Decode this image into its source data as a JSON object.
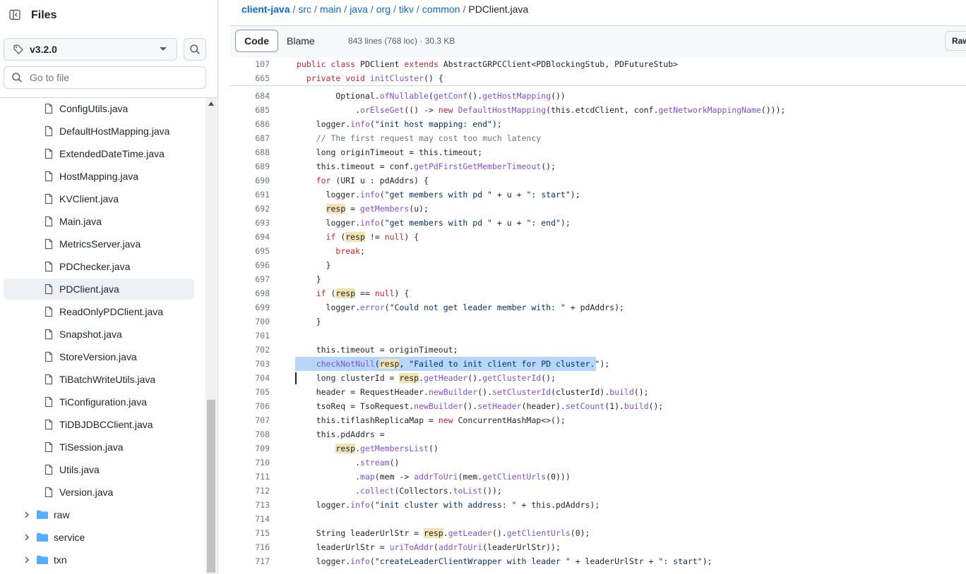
{
  "sidebar": {
    "title": "Files",
    "branch": "v3.2.0",
    "goto_placeholder": "Go to file",
    "files": [
      "ConfigUtils.java",
      "DefaultHostMapping.java",
      "ExtendedDateTime.java",
      "HostMapping.java",
      "KVClient.java",
      "Main.java",
      "MetricsServer.java",
      "PDChecker.java",
      "PDClient.java",
      "ReadOnlyPDClient.java",
      "Snapshot.java",
      "StoreVersion.java",
      "TiBatchWriteUtils.java",
      "TiConfiguration.java",
      "TiDBJDBCClient.java",
      "TiSession.java",
      "Utils.java",
      "Version.java"
    ],
    "selected_file": "PDClient.java",
    "folders": [
      "raw",
      "service",
      "txn"
    ]
  },
  "breadcrumb": {
    "items": [
      "client-java",
      "src",
      "main",
      "java",
      "org",
      "tikv",
      "common"
    ],
    "current": "PDClient.java"
  },
  "file_header": {
    "code_tab": "Code",
    "blame_tab": "Blame",
    "info": "843 lines (768 loc) · 30.3 KB",
    "raw_button": "Raw"
  },
  "sticky_lines": [
    {
      "num": "107",
      "code": "public class PDClient extends AbstractGRPCClient<PDBlockingStub, PDFutureStub>"
    },
    {
      "num": "665",
      "code": "  private void initCluster() {"
    }
  ],
  "code_lines": [
    {
      "num": "684",
      "code": "        Optional.ofNullable(getConf().getHostMapping())"
    },
    {
      "num": "685",
      "code": "            .orElseGet(() -> new DefaultHostMapping(this.etcdClient, conf.getNetworkMappingName()));"
    },
    {
      "num": "686",
      "code": "    logger.info(\"init host mapping: end\");"
    },
    {
      "num": "687",
      "code": "    // The first request may cost too much latency"
    },
    {
      "num": "688",
      "code": "    long originTimeout = this.timeout;"
    },
    {
      "num": "689",
      "code": "    this.timeout = conf.getPdFirstGetMemberTimeout();"
    },
    {
      "num": "690",
      "code": "    for (URI u : pdAddrs) {"
    },
    {
      "num": "691",
      "code": "      logger.info(\"get members with pd \" + u + \": start\");"
    },
    {
      "num": "692",
      "code": "      resp = getMembers(u);"
    },
    {
      "num": "693",
      "code": "      logger.info(\"get members with pd \" + u + \": end\");"
    },
    {
      "num": "694",
      "code": "      if (resp != null) {"
    },
    {
      "num": "695",
      "code": "        break;"
    },
    {
      "num": "696",
      "code": "      }"
    },
    {
      "num": "697",
      "code": "    }"
    },
    {
      "num": "698",
      "code": "    if (resp == null) {"
    },
    {
      "num": "699",
      "code": "      logger.error(\"Could not get leader member with: \" + pdAddrs);"
    },
    {
      "num": "700",
      "code": "    }"
    },
    {
      "num": "701",
      "code": ""
    },
    {
      "num": "702",
      "code": "    this.timeout = originTimeout;"
    },
    {
      "num": "703",
      "code": "    checkNotNull(resp, \"Failed to init client for PD cluster.\");"
    },
    {
      "num": "704",
      "code": "    long clusterId = resp.getHeader().getClusterId();"
    },
    {
      "num": "705",
      "code": "    header = RequestHeader.newBuilder().setClusterId(clusterId).build();"
    },
    {
      "num": "706",
      "code": "    tsoReq = TsoRequest.newBuilder().setHeader(header).setCount(1).build();"
    },
    {
      "num": "707",
      "code": "    this.tiflashReplicaMap = new ConcurrentHashMap<>();"
    },
    {
      "num": "708",
      "code": "    this.pdAddrs ="
    },
    {
      "num": "709",
      "code": "        resp.getMembersList()"
    },
    {
      "num": "710",
      "code": "            .stream()"
    },
    {
      "num": "711",
      "code": "            .map(mem -> addrToUri(mem.getClientUrls(0)))"
    },
    {
      "num": "712",
      "code": "            .collect(Collectors.toList());"
    },
    {
      "num": "713",
      "code": "    logger.info(\"init cluster with address: \" + this.pdAddrs);"
    },
    {
      "num": "714",
      "code": ""
    },
    {
      "num": "715",
      "code": "    String leaderUrlStr = resp.getLeader().getClientUrls(0);"
    },
    {
      "num": "716",
      "code": "    leaderUrlStr = uriToAddr(addrToUri(leaderUrlStr));"
    },
    {
      "num": "717",
      "code": "    logger.info(\"createLeaderClientWrapper with leader \" + leaderUrlStr + \": start\");"
    }
  ],
  "highlight_word": "resp",
  "colors": {
    "link": "#0969da",
    "keyword": "#cf222e",
    "function": "#8250df",
    "string": "#0a3069",
    "comment": "#6e7781",
    "selection": "#b6d7f7",
    "symbol_highlight": "#f2e3b3"
  }
}
